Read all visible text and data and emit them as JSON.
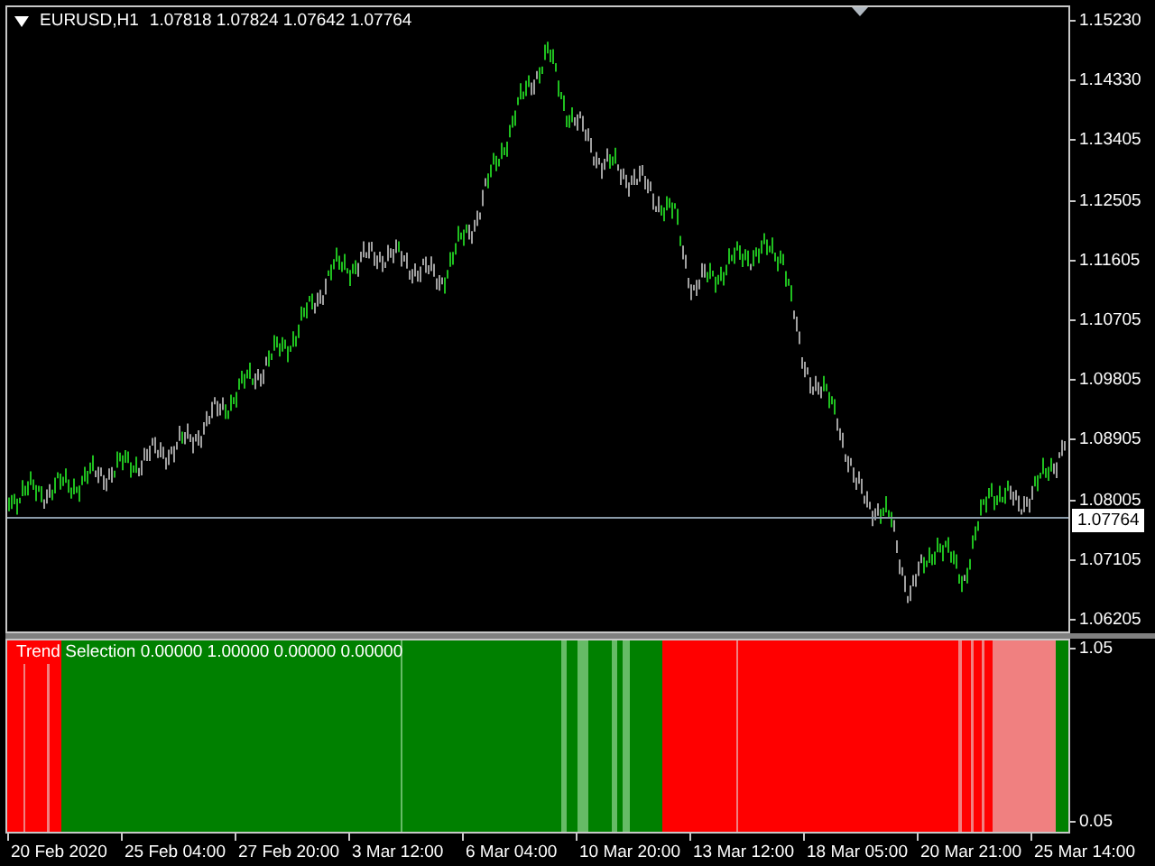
{
  "chart": {
    "title": "EURUSD,H1",
    "ohlc": "1.07818 1.07824 1.07642 1.07764"
  },
  "price_axis": {
    "labels": [
      "1.15230",
      "1.14330",
      "1.13405",
      "1.12505",
      "1.11605",
      "1.10705",
      "1.09805",
      "1.08905",
      "1.08005",
      "1.07105",
      "1.06205"
    ],
    "current_price": "1.07764"
  },
  "indicator": {
    "title": "Trend Selection 0.00000 1.00000 0.00000 0.00000",
    "axis_labels": [
      "1.05",
      "0.05"
    ]
  },
  "time_axis": {
    "labels": [
      "20 Feb 2020",
      "25 Feb 04:00",
      "27 Feb 20:00",
      "3 Mar 12:00",
      "6 Mar 04:00",
      "10 Mar 20:00",
      "13 Mar 12:00",
      "18 Mar 05:00",
      "20 Mar 21:00",
      "25 Mar 14:00"
    ]
  }
}
